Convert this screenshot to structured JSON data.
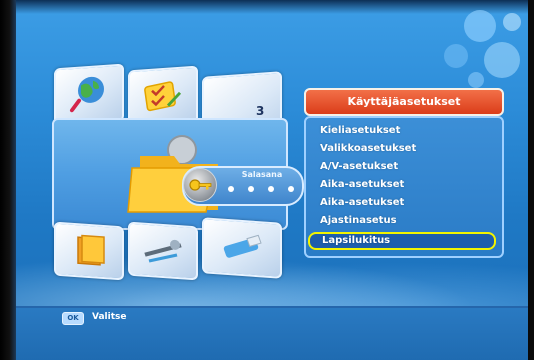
{
  "cube": {
    "active_tile_number": "3",
    "tile_icons": [
      "globe-magnifier-icon",
      "checklist-icon",
      "",
      "document-icon",
      "satellite-dish-icon",
      "tools-icon"
    ]
  },
  "password_prompt": {
    "title": "Salasana",
    "dots": 4
  },
  "menu": {
    "header": "Käyttäjäasetukset",
    "items": [
      {
        "label": "Kieliasetukset"
      },
      {
        "label": "Valikkoasetukset"
      },
      {
        "label": "A/V-asetukset"
      },
      {
        "label": "Aika-asetukset"
      },
      {
        "label": "Aika-asetukset"
      },
      {
        "label": "Ajastinasetus"
      },
      {
        "label": "Lapsilukitus",
        "selected": true
      }
    ]
  },
  "footer": {
    "ok_key_label": "OK",
    "ok_action_label": "Valitse"
  },
  "colors": {
    "background": "#2c8cd8",
    "menu_header": "#e0461f",
    "selection_border": "#f3f400"
  }
}
